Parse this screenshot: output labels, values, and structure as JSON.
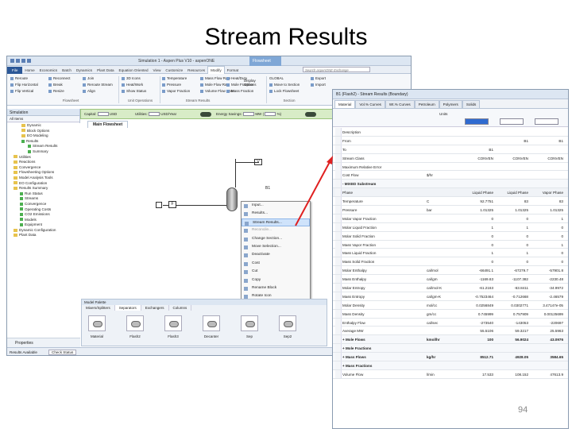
{
  "slide": {
    "title": "Stream Results",
    "page_number": "94"
  },
  "main_window": {
    "title": "Simulation 1 - Aspen Plus V10 - aspenONE",
    "context_tab": "Flowsheet",
    "tabs": [
      "File",
      "Home",
      "Economics",
      "Batch",
      "Dynamics",
      "Plant Data",
      "Equation Oriented",
      "View",
      "Customize",
      "Resources",
      "Modify",
      "Format"
    ],
    "active_tab": "Modify",
    "search_placeholder": "Search aspenONE Exchange",
    "ribbon": {
      "flowsheet_group": {
        "items": [
          "Reroute",
          "Flip Horizontal",
          "Flip Vertical"
        ],
        "items2": [
          "Reconnect",
          "Break",
          "Resize"
        ],
        "items3": [
          "Join",
          "Reroute Stream",
          "Align"
        ],
        "label": "Flowsheet"
      },
      "unit_ops_group": {
        "items": [
          "3D Icons",
          "Heat/Work",
          "Show Status"
        ],
        "label": "Unit Operations"
      },
      "stream_results_group": {
        "items": [
          "Temperature",
          "Pressure",
          "Vapor Fraction"
        ],
        "items2": [
          "Mass Flow Rate",
          "Mole Flow Rate",
          "Volume Flow Rate"
        ],
        "items3": [
          "Heat/Duty",
          "Mole Fraction",
          "Mass Fraction"
        ],
        "label": "Stream Results"
      },
      "display_options": "Display Options",
      "section_group": {
        "items": [
          "GLOBAL",
          "Move to Section",
          "Lock Flowsheet"
        ],
        "label": "Section"
      },
      "export_group": {
        "items": [
          "Export",
          "Import"
        ]
      }
    },
    "green_bar": {
      "capital_label": "Capital:",
      "capital_unit": "USD",
      "utilities_label": "Utilities:",
      "utilities_unit": "USD/Year",
      "energy_label": "Energy Savings:",
      "energy_unit": "MW",
      "energy_pct": "%)",
      "exchangers": "Exchangers"
    },
    "nav": {
      "header": "Simulation",
      "sub": "All Items",
      "tree": [
        "Dynamic",
        "Block Options",
        "EO Modeling",
        "Results",
        "Stream Results",
        "Summary",
        "Utilities",
        "Reactions",
        "Convergence",
        "Flowsheeting Options",
        "Model Analysis Tools",
        "EO Configuration",
        "Results Summary",
        "Run Status",
        "Streams",
        "Convergence",
        "Operating Costs",
        "CO2 Emissions",
        "Models",
        "Equipment",
        "Dynamic Configuration",
        "Plant Data"
      ],
      "buttons": [
        "Properties",
        "Simulation",
        "Safety Analysis",
        "Energy Analysis"
      ]
    },
    "status": {
      "results": "Results Available",
      "check": "Check Status",
      "zoom": "101%"
    },
    "flowsheet_tab": "Main Flowsheet",
    "stream_labels": {
      "v": "V",
      "f": "F",
      "l": "L",
      "b1": "B1"
    },
    "context_menu": [
      "Input...",
      "Results...",
      "Stream Results...",
      "Reconcile...",
      "Change Section...",
      "Move Selection...",
      "Deactivate",
      "Cost",
      "Cut",
      "Copy",
      "Rename Block",
      "Rotate Icon",
      "Exchange Icon",
      "Hide"
    ],
    "palette": {
      "title": "Model Palette",
      "tabs": [
        "Mixers/Splitters",
        "Separators",
        "Exchangers",
        "Columns"
      ],
      "items": [
        "Material",
        "Flash2",
        "Flash3",
        "Decanter",
        "Sep",
        "Sep2"
      ]
    }
  },
  "results_window": {
    "title": "B1 (Flash2) - Stream Results (Boundary)",
    "tabs": [
      "Material",
      "Vol.% Curves",
      "Wt.% Curves",
      "Petroleum",
      "Polymers",
      "Solids"
    ],
    "units_header": "Units",
    "rows": [
      {
        "c1": "Description",
        "c2": "",
        "c3": "",
        "c4": "",
        "c5": ""
      },
      {
        "c1": "From",
        "c2": "",
        "c3": "",
        "c4": "B1",
        "c5": "B1"
      },
      {
        "c1": "To",
        "c2": "",
        "c3": "B1",
        "c4": "",
        "c5": ""
      },
      {
        "c1": "Stream Class",
        "c2": "",
        "c3": "CONVEN",
        "c4": "CONVEN",
        "c5": "CONVEN"
      },
      {
        "c1": "Maximum Relative Error",
        "c2": "",
        "c3": "",
        "c4": "",
        "c5": ""
      },
      {
        "c1": "Cost Flow",
        "c2": "$/hr",
        "c3": "",
        "c4": "",
        "c5": ""
      },
      {
        "c1": "- MIXED Substream",
        "c2": "",
        "c3": "",
        "c4": "",
        "c5": "",
        "section": true
      },
      {
        "c1": "Phase",
        "c2": "",
        "c3": "Liquid Phase",
        "c4": "Liquid Phase",
        "c5": "Vapor Phase"
      },
      {
        "c1": "Temperature",
        "c2": "C",
        "c3": "92.7751",
        "c4": "83",
        "c5": "83"
      },
      {
        "c1": "Pressure",
        "c2": "bar",
        "c3": "1.01325",
        "c4": "1.01325",
        "c5": "1.01325"
      },
      {
        "c1": "Molar Vapor Fraction",
        "c2": "",
        "c3": "0",
        "c4": "0",
        "c5": "1"
      },
      {
        "c1": "Molar Liquid Fraction",
        "c2": "",
        "c3": "1",
        "c4": "1",
        "c5": "0"
      },
      {
        "c1": "Molar Solid Fraction",
        "c2": "",
        "c3": "0",
        "c4": "0",
        "c5": "0"
      },
      {
        "c1": "Mass Vapor Fraction",
        "c2": "",
        "c3": "0",
        "c4": "0",
        "c5": "1"
      },
      {
        "c1": "Mass Liquid Fraction",
        "c2": "",
        "c3": "1",
        "c4": "1",
        "c5": "0"
      },
      {
        "c1": "Mass Solid Fraction",
        "c2": "",
        "c3": "0",
        "c4": "0",
        "c5": "0"
      },
      {
        "c1": "Molar Enthalpy",
        "c2": "cal/mol",
        "c3": "-66491.1",
        "c4": "-67279.7",
        "c5": "-57901.8"
      },
      {
        "c1": "Mass Enthalpy",
        "c2": "cal/gm",
        "c3": "-1169.63",
        "c4": "-1107.382",
        "c5": "-2230.48"
      },
      {
        "c1": "Molar Entropy",
        "c2": "cal/mol-K",
        "c3": "-61.2163",
        "c4": "-63.8411",
        "c5": "-34.9972"
      },
      {
        "c1": "Mass Entropy",
        "c2": "cal/gm-K",
        "c3": "-0.7523464",
        "c4": "-0.712668",
        "c5": "-2.46579"
      },
      {
        "c1": "Molar Density",
        "c2": "mol/cc",
        "c3": "0.0256849",
        "c4": "0.0302771",
        "c5": "3.47147e-05"
      },
      {
        "c1": "Mass Density",
        "c2": "gm/cc",
        "c3": "0.745999",
        "c4": "0.757909",
        "c5": "0.00125699"
      },
      {
        "c1": "Enthalpy Flow",
        "c2": "cal/sec",
        "c3": "-273540",
        "c4": "-143053",
        "c5": "-220697"
      },
      {
        "c1": "Average MW",
        "c2": "",
        "c3": "55.5106",
        "c4": "59.3217",
        "c5": "25.5963"
      },
      {
        "c1": "+ Mole Flows",
        "c2": "kmol/hr",
        "c3": "100",
        "c4": "56.9024",
        "c5": "43.0976",
        "section": true
      },
      {
        "c1": "+ Mole Fractions",
        "c2": "",
        "c3": "",
        "c4": "",
        "c5": "",
        "section": true
      },
      {
        "c1": "+ Mass Flows",
        "c2": "kg/hr",
        "c3": "8512.71",
        "c4": "4928.05",
        "c5": "3584.65",
        "section": true
      },
      {
        "c1": "+ Mass Fractions",
        "c2": "",
        "c3": "",
        "c4": "",
        "c5": "",
        "section": true
      },
      {
        "c1": "Volume Flow",
        "c2": "l/min",
        "c3": "17.533",
        "c4": "108.152",
        "c5": "47613.9"
      }
    ]
  },
  "colors": {
    "accent": "#2b5797",
    "highlight": "#f6c776",
    "arrow": "#e02020"
  }
}
